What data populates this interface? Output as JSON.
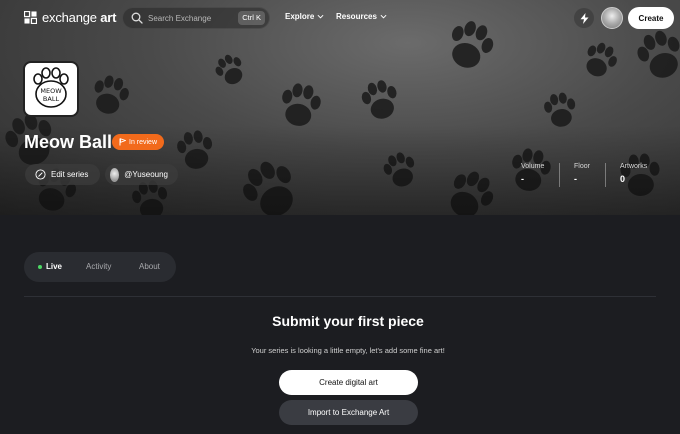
{
  "header": {
    "logo_text_light": "exchange",
    "logo_text_bold": "art",
    "search_placeholder": "Search Exchange",
    "search_shortcut": "Ctrl K",
    "nav": [
      {
        "label": "Explore"
      },
      {
        "label": "Resources"
      }
    ],
    "create_label": "Create"
  },
  "series": {
    "title": "Meow Ball",
    "status_badge": "In review",
    "thumbnail_text": "MEOW BALL",
    "edit_label": "Edit series",
    "owner_handle": "@Yuseoung",
    "stats": [
      {
        "label": "Volume",
        "value": "-"
      },
      {
        "label": "Floor",
        "value": "-"
      },
      {
        "label": "Artworks",
        "value": "0"
      }
    ]
  },
  "tabs": [
    {
      "label": "Live",
      "active": true
    },
    {
      "label": "Activity",
      "active": false
    },
    {
      "label": "About",
      "active": false
    }
  ],
  "empty_state": {
    "title": "Submit your first piece",
    "subtitle": "Your series is looking a little empty, let's add some fine art!",
    "primary_button": "Create digital art",
    "secondary_button": "Import to Exchange Art"
  },
  "colors": {
    "badge": "#f26a1b",
    "live_dot": "#4cd964",
    "page_bg": "#1c1d21"
  }
}
